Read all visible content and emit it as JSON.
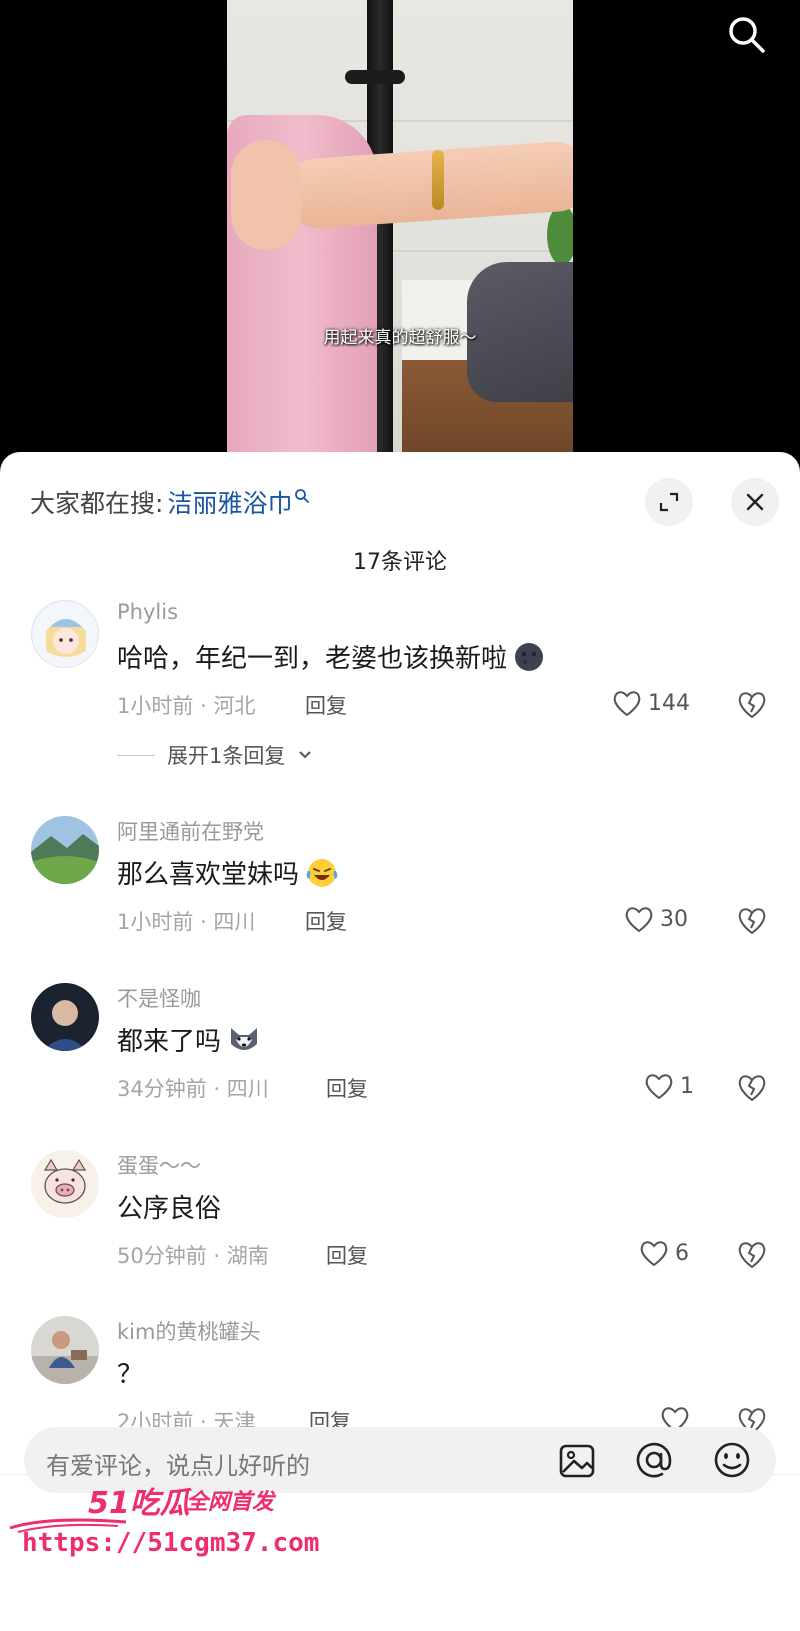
{
  "video": {
    "caption": "用起来真的超舒服～"
  },
  "search_icon": "search-icon",
  "hot_search": {
    "label": "大家都在搜:",
    "term": "洁丽雅浴巾",
    "icon": "magnifier-icon"
  },
  "header_buttons": {
    "expand_icon": "expand-icon",
    "close_icon": "close-icon"
  },
  "comment_count": "17条评论",
  "comments": [
    {
      "user": "Phylis",
      "text": "哈哈，年纪一到，老婆也该换新啦",
      "emoji": "dark-moon-face",
      "meta": "1小时前 · 河北",
      "reply": "回复",
      "likes": "144",
      "replies_label": "展开1条回复"
    },
    {
      "user": "阿里通前在野党",
      "text": "那么喜欢堂妹吗",
      "emoji": "laughing-crying-face",
      "meta": "1小时前 · 四川",
      "reply": "回复",
      "likes": "30"
    },
    {
      "user": "不是怪咖",
      "text": "都来了吗",
      "emoji": "husky-dog",
      "meta": "34分钟前 · 四川",
      "reply": "回复",
      "likes": "1"
    },
    {
      "user": "蛋蛋～～",
      "text": "公序良俗",
      "meta": "50分钟前 · 湖南",
      "reply": "回复",
      "likes": "6"
    },
    {
      "user": "kim的黄桃罐头",
      "text": "？",
      "meta": "2小时前 · 天津",
      "reply": "回复",
      "likes": ""
    }
  ],
  "input": {
    "placeholder": "有爱评论，说点儿好听的"
  },
  "watermark": {
    "logo": "51吃瓜",
    "slogan": "全网首发",
    "url": "https://51cgm37.com"
  },
  "colors": {
    "link": "#1c56a0",
    "watermark": "#ee2d6f"
  }
}
